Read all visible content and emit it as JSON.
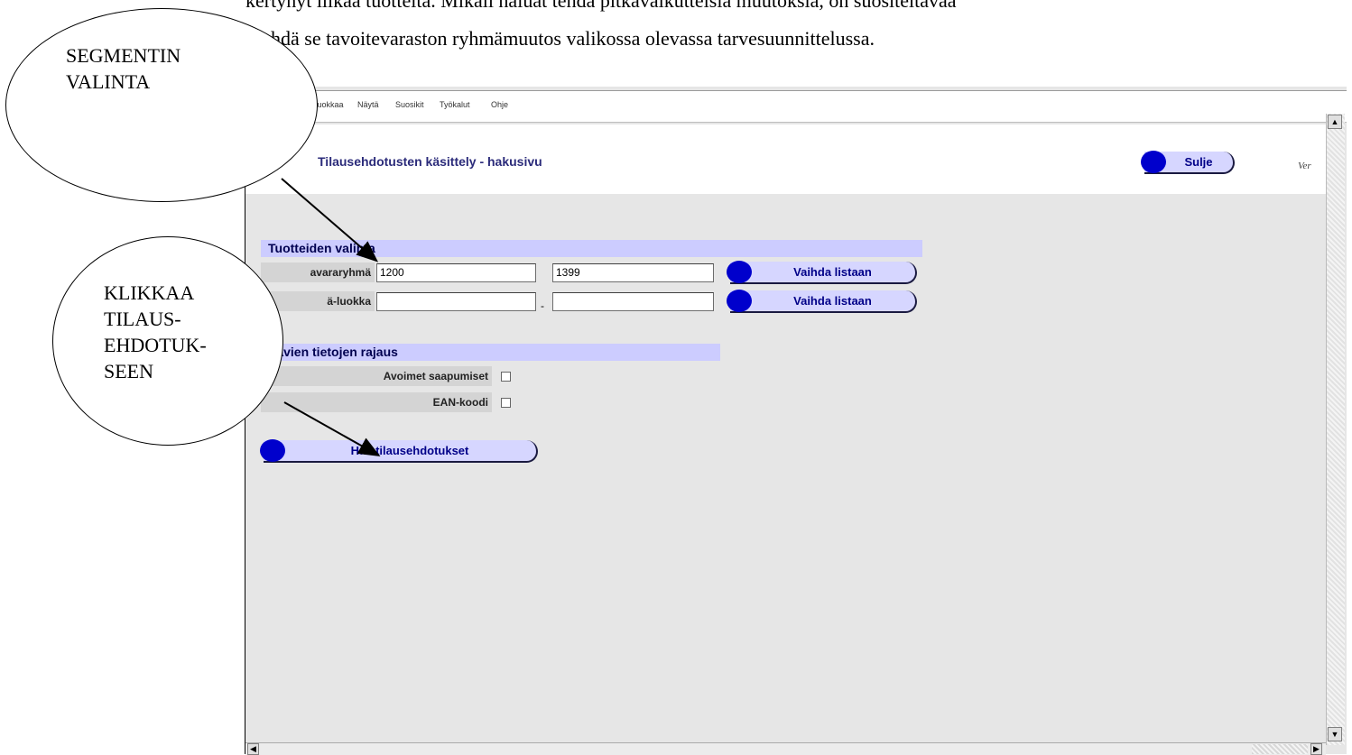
{
  "doc": {
    "line1": "kertynyt liikaa tuotteita. Mikäli haluat tehdä pitkävaikutteisia muutoksia, on suositeltavaa",
    "line2": "hdä se tavoitevaraston ryhmämuutos valikossa olevassa tarvesuunnittelussa."
  },
  "menu": [
    "Muokkaa",
    "Näytä",
    "Suosikit",
    "Työkalut",
    "Ohje"
  ],
  "header": {
    "title": "Tilausehdotusten käsittely - hakusivu",
    "close_label": "Sulje",
    "version_text": "Ver"
  },
  "product_selection": {
    "section_title": "Tuotteiden valinta",
    "row1": {
      "label": "avararyhmä",
      "from": "1200",
      "to": "1399",
      "button": "Vaihda listaan"
    },
    "row2": {
      "label": "ä-luokka",
      "from": "",
      "separator": "-",
      "to": "",
      "button": "Vaihda listaan"
    }
  },
  "data_filter": {
    "section_title": "ttavien tietojen rajaus",
    "option1": "Avoimet saapumiset",
    "option2": "EAN-koodi"
  },
  "search_button": "Hae tilausehdotukset",
  "callouts": {
    "segment": "SEGMENTIN\nVALINTA",
    "click": "KLIKKAA\nTILAUS-\nEHDOTUK-\nSEEN"
  }
}
